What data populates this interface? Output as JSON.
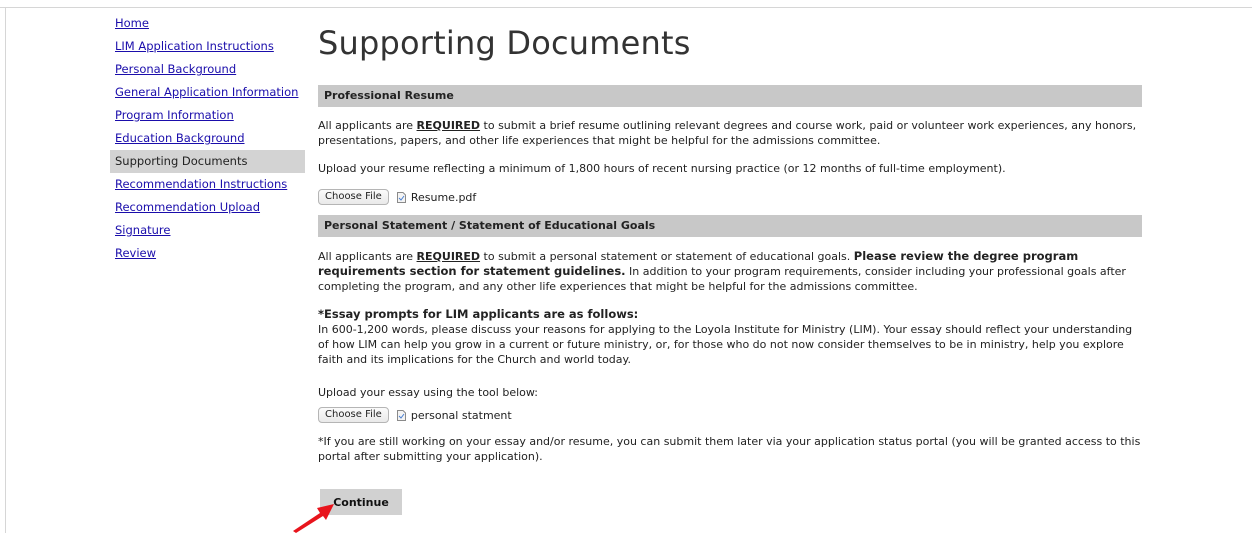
{
  "sidebar": {
    "items": [
      {
        "label": "Home",
        "active": false
      },
      {
        "label": "LIM Application Instructions",
        "active": false
      },
      {
        "label": "Personal Background",
        "active": false
      },
      {
        "label": "General Application Information",
        "active": false
      },
      {
        "label": "Program Information",
        "active": false
      },
      {
        "label": "Education Background",
        "active": false
      },
      {
        "label": "Supporting Documents",
        "active": true
      },
      {
        "label": "Recommendation Instructions",
        "active": false
      },
      {
        "label": "Recommendation Upload",
        "active": false
      },
      {
        "label": "Signature",
        "active": false
      },
      {
        "label": "Review",
        "active": false
      }
    ]
  },
  "page": {
    "title": "Supporting Documents"
  },
  "resume": {
    "header": "Professional Resume",
    "p1_pre": "All applicants are ",
    "p1_required": "REQUIRED",
    "p1_post": " to submit a brief resume outlining relevant degrees and course work, paid or volunteer work experiences, any honors, presentations, papers, and other life experiences that might be helpful for the admissions committee.",
    "p2": "Upload your resume reflecting a minimum of 1,800 hours of recent nursing practice (or 12 months of full-time employment).",
    "choose_label": "Choose File",
    "file_name": "Resume.pdf"
  },
  "statement": {
    "header": "Personal Statement / Statement of Educational Goals",
    "p1_pre": "All applicants are ",
    "p1_required": "REQUIRED",
    "p1_mid": " to submit a personal statement or statement of educational goals. ",
    "p1_bold": "Please review the degree program requirements section for statement guidelines.",
    "p1_post": " In addition to your program requirements, consider including your professional goals after completing the program, and any other life experiences that might be helpful for the admissions committee.",
    "prompt_heading": "*Essay prompts for LIM applicants are as follows:",
    "prompt_body": "In 600-1,200 words, please discuss your reasons for applying to the Loyola Institute for Ministry (LIM). Your essay should reflect your understanding of how LIM can help you grow in a current or future ministry, or, for those who do not now consider themselves to be in ministry, help you explore faith and its implications for the Church and world today.",
    "upload_text": "Upload your essay using the tool below:",
    "choose_label": "Choose File",
    "file_name": "personal statment",
    "note": "*If you are still working on your essay and/or resume, you can submit them later via your application status portal (you will be granted access to this portal after submitting your application)."
  },
  "actions": {
    "continue_label": "Continue"
  },
  "colors": {
    "link": "#1a0dab",
    "section_header_bg": "#c8c8c8",
    "active_nav_bg": "#d3d3d3",
    "annotation_arrow": "#e8141c"
  },
  "icons": {
    "file": "file-icon",
    "arrow": "red-arrow-icon"
  }
}
